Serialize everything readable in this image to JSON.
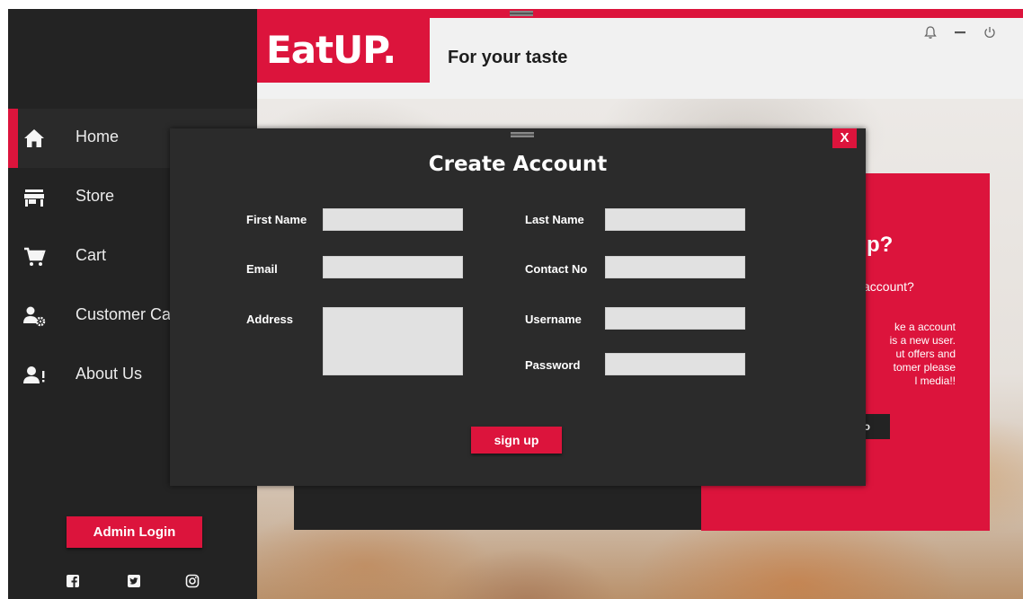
{
  "header": {
    "logo": "EatUP.",
    "tagline": "For your taste"
  },
  "sidebar": {
    "items": [
      {
        "label": "Home",
        "icon": "home-icon",
        "active": true
      },
      {
        "label": "Store",
        "icon": "store-icon",
        "active": false
      },
      {
        "label": "Cart",
        "icon": "cart-icon",
        "active": false
      },
      {
        "label": "Customer Ca",
        "icon": "customer-care-icon",
        "active": false
      },
      {
        "label": "About Us",
        "icon": "about-us-icon",
        "active": false
      }
    ],
    "admin_login": "Admin Login",
    "social": [
      "facebook-icon",
      "twitter-icon",
      "instagram-icon"
    ]
  },
  "window_controls": [
    "bell-icon",
    "minimize-icon",
    "power-icon"
  ],
  "signup_panel": {
    "heading": "p?",
    "question": "account?",
    "text_lines": [
      "ke a account",
      "is a new user.",
      "ut offers and",
      "tomer please",
      "l media!!"
    ],
    "button": "o"
  },
  "modal": {
    "title": "Create Account",
    "close": "X",
    "fields": {
      "first_name": {
        "label": "First Name",
        "value": ""
      },
      "last_name": {
        "label": "Last Name",
        "value": ""
      },
      "email": {
        "label": "Email",
        "value": ""
      },
      "contact_no": {
        "label": "Contact No",
        "value": ""
      },
      "address": {
        "label": "Address",
        "value": ""
      },
      "username": {
        "label": "Username",
        "value": ""
      },
      "password": {
        "label": "Password",
        "value": ""
      }
    },
    "submit": "sign up"
  },
  "colors": {
    "accent": "#dc143c",
    "sidebar_bg": "#232323",
    "modal_bg": "#2b2b2b",
    "input_bg": "#e1e1e1"
  }
}
